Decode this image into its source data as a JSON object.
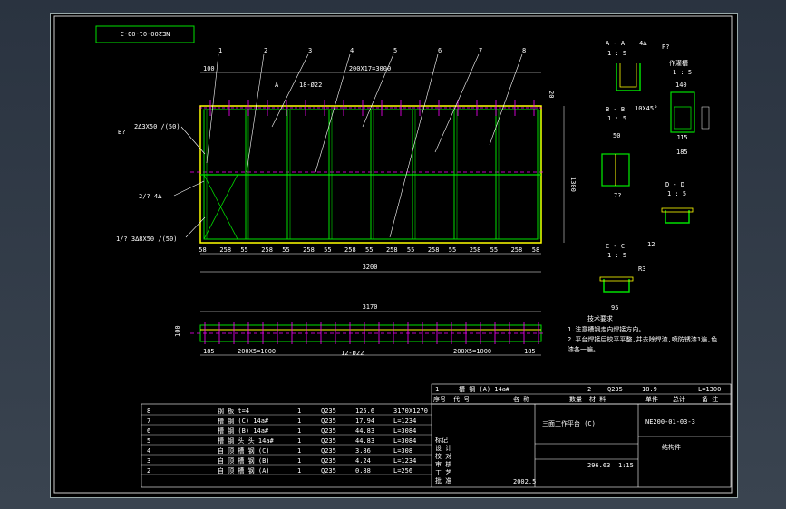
{
  "drawing": {
    "code_mirrored": "NE200-01-03-3",
    "top_dim": "200X17=3000",
    "left_dim_100": "100",
    "callout_a": "A",
    "callout_holes": "18-Ø22",
    "callout_b": "B?",
    "note_weld_1": "2∆3X50 ∕(50)",
    "note_weld_2": "2∕? 4∆",
    "note_weld_3": "1∕? 3∆8X50 ∕(50)",
    "spacing": [
      "58",
      "258",
      "55",
      "258",
      "55",
      "258",
      "55",
      "258",
      "55",
      "258",
      "55",
      "258",
      "55",
      "258",
      "55",
      "258",
      "58"
    ],
    "width_total": "3200",
    "height_total": "1300",
    "right_dim_20": "20",
    "side_total": "3170",
    "side_left": "185",
    "side_mid1": "200X5=1000",
    "side_mid2": "200X5=1000",
    "side_right": "185",
    "side_height": "100",
    "side_holes": "12-Ø22",
    "parts_numbers": [
      "1",
      "2",
      "3",
      "4",
      "5",
      "6",
      "7",
      "8"
    ]
  },
  "details": {
    "aa_label": "A - A",
    "aa_scale": "1 : 5",
    "aa_weld": "4∆",
    "aa_ref": "P?",
    "pin_label": "作灌槽",
    "pin_scale": "1 : 5",
    "pin_dim": "140",
    "pin_chamfer": "10X45°",
    "pin_dim2": "J15",
    "pin_dim3": "185",
    "bb_label": "B - B",
    "bb_scale": "1 : 5",
    "bb_dim": "50",
    "dd_label": "D - D",
    "dd_scale": "1 : 5",
    "dd_ref": "7?",
    "dd_dim": "12",
    "cc_label": "C - C",
    "cc_scale": "1 : 5",
    "cc_r": "R3",
    "cc_dim": "95"
  },
  "notes": {
    "title": "技术要求",
    "line1": "1.注意槽钢走向焊接方向。",
    "line2": "2.平台焊接后校平平整,并去除焊渣,喷防锈漆1遍,色",
    "line3": "漆各一遍。"
  },
  "bom_top": {
    "row": [
      "1",
      "槽 钢 (A)  14a#",
      "2",
      "Q235",
      "18.9",
      "",
      "L=1300"
    ],
    "header": [
      "序号",
      "代 号",
      "名 称",
      "数量",
      "材 料",
      "单件",
      "总计",
      "备 注"
    ]
  },
  "bom": [
    {
      "no": "8",
      "name": "钢 板   t=4",
      "qty": "1",
      "mat": "Q235",
      "w": "125.6",
      "note": "3170X1270"
    },
    {
      "no": "7",
      "name": "槽 钢 (C)  14a#",
      "qty": "1",
      "mat": "Q235",
      "w": "17.94",
      "note": "L=1234"
    },
    {
      "no": "6",
      "name": "槽 钢 (B)  14a#",
      "qty": "1",
      "mat": "Q235",
      "w": "44.83",
      "note": "L=3084"
    },
    {
      "no": "5",
      "name": "槽 钢 头 头  14a#",
      "qty": "1",
      "mat": "Q235",
      "w": "44.83",
      "note": "L=3084"
    },
    {
      "no": "4",
      "name": "自 顶 槽 钢 (C)",
      "qty": "1",
      "mat": "Q235",
      "w": "3.86",
      "note": "L=308"
    },
    {
      "no": "3",
      "name": "自 顶 槽 钢 (B)",
      "qty": "1",
      "mat": "Q235",
      "w": "4.24",
      "note": "L=1234"
    },
    {
      "no": "2",
      "name": "自 顶 槽 钢 (A)",
      "qty": "1",
      "mat": "Q235",
      "w": "0.88",
      "note": "L=256"
    }
  ],
  "title_block": {
    "project": "三面工作平台 (C)",
    "drawing_no": "NE200-01-03-3",
    "part": "结构件",
    "weight": "296.63",
    "scale": "1:15",
    "date": "2002.5",
    "roles": [
      "标记",
      "设 计",
      "校 对",
      "审 核",
      "工 艺",
      "批 准"
    ]
  },
  "colors": {
    "green": "#00e000",
    "yellow": "#ffff00",
    "magenta": "#ff00ff",
    "white": "#ffffff",
    "cyan": "#00ffff"
  }
}
